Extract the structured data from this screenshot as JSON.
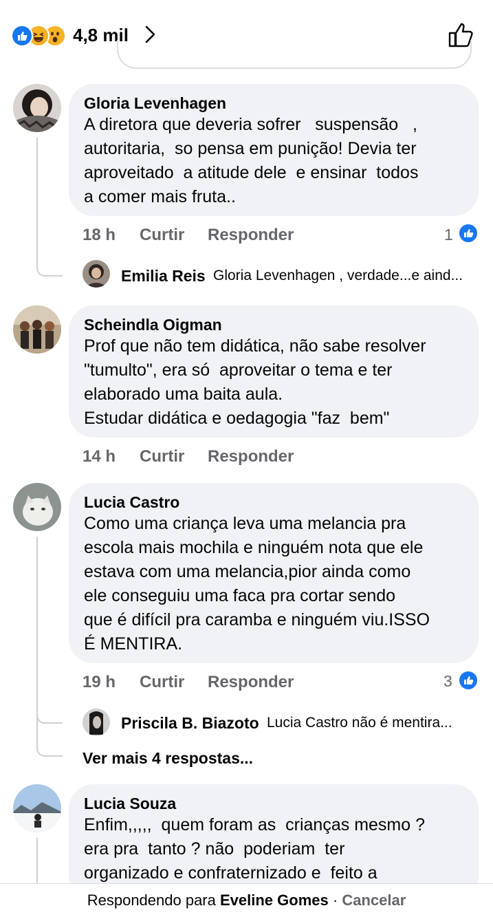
{
  "header": {
    "reaction_count": "4,8 mil",
    "reaction_icons": [
      "like-reaction-icon",
      "haha-reaction-icon",
      "wow-reaction-icon"
    ]
  },
  "comments": [
    {
      "name": "Gloria Levenhagen",
      "lines": [
        "A diretora que deveria sofrer   suspensão   ,",
        "autoritaria,  so pensa em punição! Devia ter",
        "aproveitado  a atitude dele  e ensinar  todos",
        "a comer mais fruta.."
      ],
      "time": "18 h",
      "like_label": "Curtir",
      "reply_label": "Responder",
      "likes": "1",
      "reply": {
        "name": "Emilia Reis",
        "text": "Gloria Levenhagen , verdade...e aind..."
      }
    },
    {
      "name": "Scheindla Oigman",
      "lines": [
        "Prof que não tem didática, não sabe resolver",
        "\"tumulto\", era só  aproveitar o tema e ter",
        "elaborado uma baita aula.",
        "Estudar didática e oedagogia \"faz  bem\""
      ],
      "time": "14 h",
      "like_label": "Curtir",
      "reply_label": "Responder"
    },
    {
      "name": "Lucia Castro",
      "lines": [
        "Como uma criança leva uma melancia pra",
        "escola mais mochila e ninguém nota que ele",
        "estava com uma melancia,pior ainda como",
        "ele conseguiu uma faca pra cortar sendo",
        "que é difícil pra caramba e ninguém viu.ISSO",
        "É MENTIRA."
      ],
      "time": "19 h",
      "like_label": "Curtir",
      "reply_label": "Responder",
      "likes": "3",
      "reply": {
        "name": "Priscila B. Biazoto",
        "text": "Lucia Castro não é mentira..."
      },
      "more_replies": "Ver mais 4 respostas..."
    },
    {
      "name": "Lucia Souza",
      "lines": [
        "Enfim,,,,,  quem foram as  crianças mesmo ?",
        "era pra  tanto ? não  poderiam  ter",
        "organizado e confraternizado e  feito a"
      ]
    }
  ],
  "footer": {
    "prefix": "Respondendo para",
    "target": "Eveline Gomes",
    "separator": "·",
    "cancel": "Cancelar"
  },
  "colors": {
    "like_blue": "#1877f2",
    "bubble_bg": "#f0f2f5",
    "meta_gray": "#65676b"
  }
}
